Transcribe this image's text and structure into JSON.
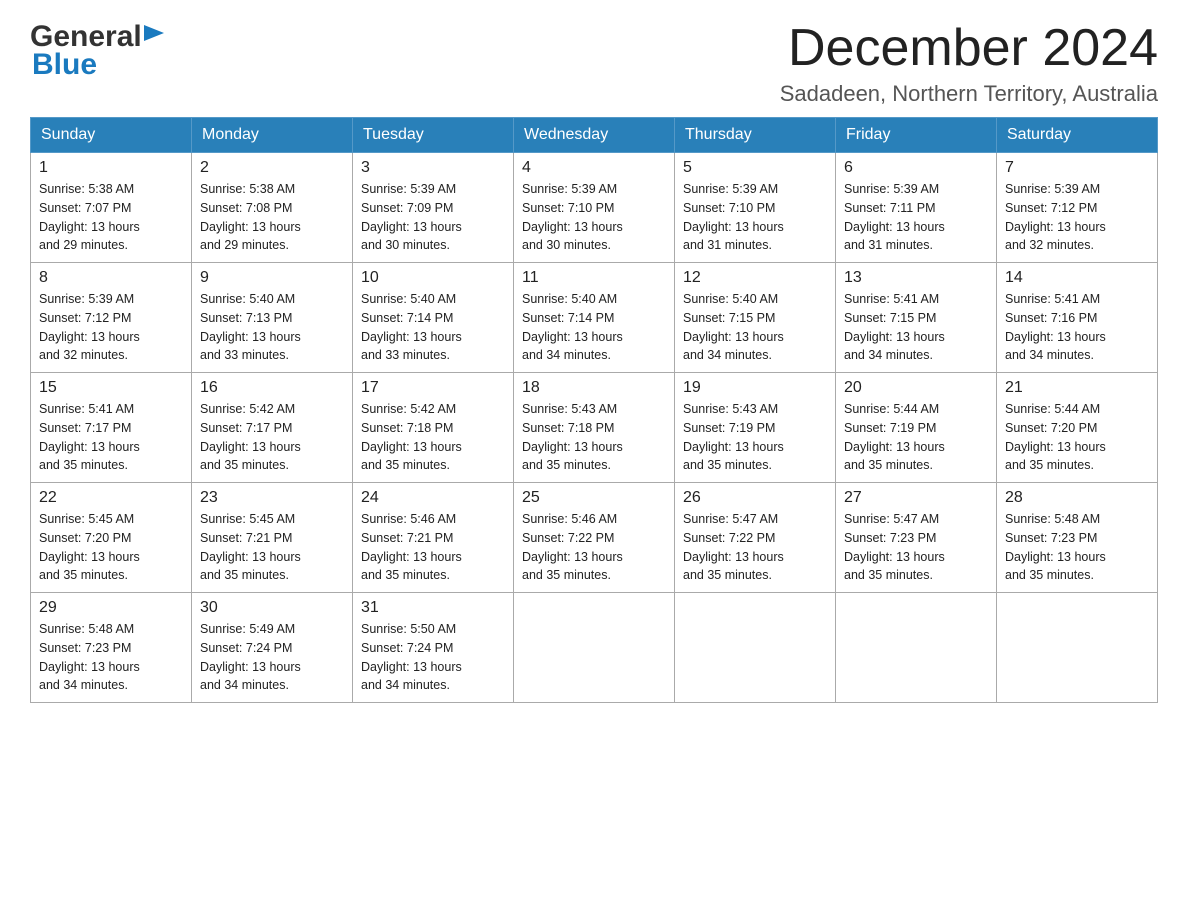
{
  "header": {
    "logo_general": "General",
    "logo_blue": "Blue",
    "month_title": "December 2024",
    "location": "Sadadeen, Northern Territory, Australia"
  },
  "days_of_week": [
    "Sunday",
    "Monday",
    "Tuesday",
    "Wednesday",
    "Thursday",
    "Friday",
    "Saturday"
  ],
  "weeks": [
    [
      {
        "day": "1",
        "sunrise": "5:38 AM",
        "sunset": "7:07 PM",
        "daylight": "13 hours and 29 minutes."
      },
      {
        "day": "2",
        "sunrise": "5:38 AM",
        "sunset": "7:08 PM",
        "daylight": "13 hours and 29 minutes."
      },
      {
        "day": "3",
        "sunrise": "5:39 AM",
        "sunset": "7:09 PM",
        "daylight": "13 hours and 30 minutes."
      },
      {
        "day": "4",
        "sunrise": "5:39 AM",
        "sunset": "7:10 PM",
        "daylight": "13 hours and 30 minutes."
      },
      {
        "day": "5",
        "sunrise": "5:39 AM",
        "sunset": "7:10 PM",
        "daylight": "13 hours and 31 minutes."
      },
      {
        "day": "6",
        "sunrise": "5:39 AM",
        "sunset": "7:11 PM",
        "daylight": "13 hours and 31 minutes."
      },
      {
        "day": "7",
        "sunrise": "5:39 AM",
        "sunset": "7:12 PM",
        "daylight": "13 hours and 32 minutes."
      }
    ],
    [
      {
        "day": "8",
        "sunrise": "5:39 AM",
        "sunset": "7:12 PM",
        "daylight": "13 hours and 32 minutes."
      },
      {
        "day": "9",
        "sunrise": "5:40 AM",
        "sunset": "7:13 PM",
        "daylight": "13 hours and 33 minutes."
      },
      {
        "day": "10",
        "sunrise": "5:40 AM",
        "sunset": "7:14 PM",
        "daylight": "13 hours and 33 minutes."
      },
      {
        "day": "11",
        "sunrise": "5:40 AM",
        "sunset": "7:14 PM",
        "daylight": "13 hours and 34 minutes."
      },
      {
        "day": "12",
        "sunrise": "5:40 AM",
        "sunset": "7:15 PM",
        "daylight": "13 hours and 34 minutes."
      },
      {
        "day": "13",
        "sunrise": "5:41 AM",
        "sunset": "7:15 PM",
        "daylight": "13 hours and 34 minutes."
      },
      {
        "day": "14",
        "sunrise": "5:41 AM",
        "sunset": "7:16 PM",
        "daylight": "13 hours and 34 minutes."
      }
    ],
    [
      {
        "day": "15",
        "sunrise": "5:41 AM",
        "sunset": "7:17 PM",
        "daylight": "13 hours and 35 minutes."
      },
      {
        "day": "16",
        "sunrise": "5:42 AM",
        "sunset": "7:17 PM",
        "daylight": "13 hours and 35 minutes."
      },
      {
        "day": "17",
        "sunrise": "5:42 AM",
        "sunset": "7:18 PM",
        "daylight": "13 hours and 35 minutes."
      },
      {
        "day": "18",
        "sunrise": "5:43 AM",
        "sunset": "7:18 PM",
        "daylight": "13 hours and 35 minutes."
      },
      {
        "day": "19",
        "sunrise": "5:43 AM",
        "sunset": "7:19 PM",
        "daylight": "13 hours and 35 minutes."
      },
      {
        "day": "20",
        "sunrise": "5:44 AM",
        "sunset": "7:19 PM",
        "daylight": "13 hours and 35 minutes."
      },
      {
        "day": "21",
        "sunrise": "5:44 AM",
        "sunset": "7:20 PM",
        "daylight": "13 hours and 35 minutes."
      }
    ],
    [
      {
        "day": "22",
        "sunrise": "5:45 AM",
        "sunset": "7:20 PM",
        "daylight": "13 hours and 35 minutes."
      },
      {
        "day": "23",
        "sunrise": "5:45 AM",
        "sunset": "7:21 PM",
        "daylight": "13 hours and 35 minutes."
      },
      {
        "day": "24",
        "sunrise": "5:46 AM",
        "sunset": "7:21 PM",
        "daylight": "13 hours and 35 minutes."
      },
      {
        "day": "25",
        "sunrise": "5:46 AM",
        "sunset": "7:22 PM",
        "daylight": "13 hours and 35 minutes."
      },
      {
        "day": "26",
        "sunrise": "5:47 AM",
        "sunset": "7:22 PM",
        "daylight": "13 hours and 35 minutes."
      },
      {
        "day": "27",
        "sunrise": "5:47 AM",
        "sunset": "7:23 PM",
        "daylight": "13 hours and 35 minutes."
      },
      {
        "day": "28",
        "sunrise": "5:48 AM",
        "sunset": "7:23 PM",
        "daylight": "13 hours and 35 minutes."
      }
    ],
    [
      {
        "day": "29",
        "sunrise": "5:48 AM",
        "sunset": "7:23 PM",
        "daylight": "13 hours and 34 minutes."
      },
      {
        "day": "30",
        "sunrise": "5:49 AM",
        "sunset": "7:24 PM",
        "daylight": "13 hours and 34 minutes."
      },
      {
        "day": "31",
        "sunrise": "5:50 AM",
        "sunset": "7:24 PM",
        "daylight": "13 hours and 34 minutes."
      },
      null,
      null,
      null,
      null
    ]
  ],
  "labels": {
    "sunrise_prefix": "Sunrise: ",
    "sunset_prefix": "Sunset: ",
    "daylight_prefix": "Daylight: "
  }
}
